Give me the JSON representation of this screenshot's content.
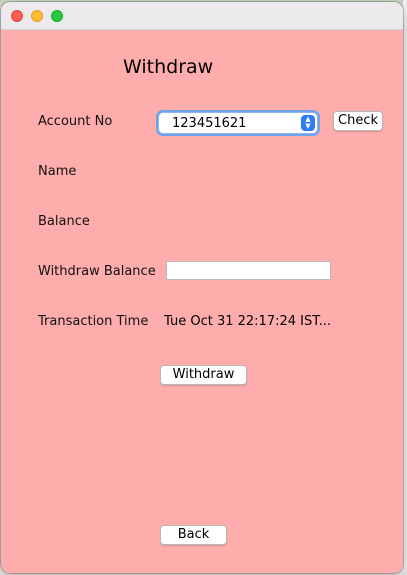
{
  "window": {
    "background": "#ffacac"
  },
  "form": {
    "title": "Withdraw",
    "account_label": "Account No",
    "account_value": "123451621",
    "check_label": "Check",
    "name_label": "Name",
    "balance_label": "Balance",
    "withdraw_balance_label": "Withdraw Balance",
    "withdraw_balance_value": "",
    "transaction_time_label": "Transaction Time",
    "transaction_time_value": "Tue Oct 31 22:17:24 IST...",
    "withdraw_button_label": "Withdraw",
    "back_button_label": "Back"
  },
  "icons": {
    "combo_arrows": "up-down-chevron-icon"
  }
}
